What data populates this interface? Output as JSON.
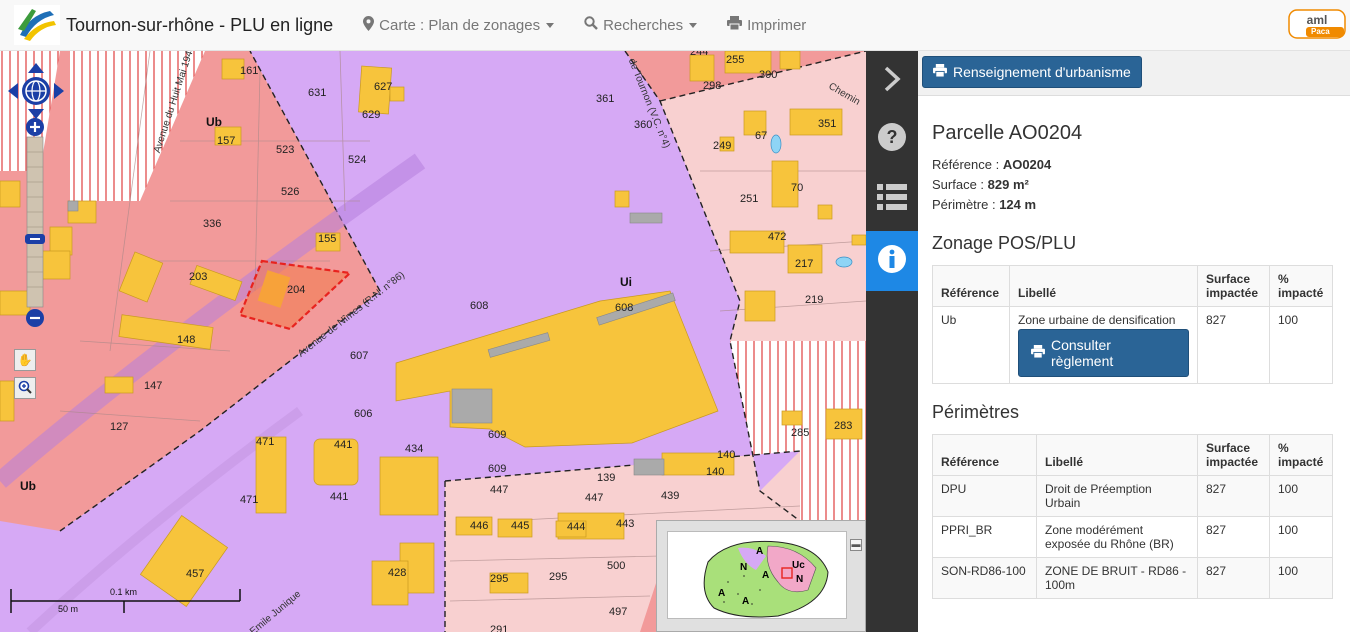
{
  "header": {
    "title": "Tournon-sur-rhône - PLU en ligne",
    "nav": [
      {
        "icon": "map-marker-icon",
        "label": "Carte : Plan de zonages"
      },
      {
        "icon": "search-icon",
        "label": "Recherches"
      },
      {
        "icon": "print-icon",
        "label": "Imprimer"
      }
    ],
    "brand_label": "Paca"
  },
  "map": {
    "zones": [
      "Ub",
      "Ui",
      "Ub"
    ],
    "parcels": [
      "161",
      "631",
      "627",
      "629",
      "157",
      "523",
      "524",
      "526",
      "336",
      "155",
      "203",
      "204",
      "148",
      "607",
      "147",
      "127",
      "606",
      "471",
      "441",
      "434",
      "471",
      "441",
      "608",
      "608",
      "609",
      "609",
      "361",
      "360",
      "249",
      "67",
      "351",
      "70",
      "251",
      "472",
      "217",
      "219",
      "285",
      "283",
      "139",
      "140",
      "140",
      "447",
      "447",
      "439",
      "446",
      "445",
      "444",
      "443",
      "295",
      "295",
      "500",
      "497",
      "291",
      "457",
      "428",
      "244",
      "255",
      "300",
      "298"
    ],
    "streets": [
      "Avenue du Huit Mai 1945",
      "Avenue de Nîmes (R.N. n°86)",
      "de Tournon (V.C. n°4)",
      "Chemin",
      "Emile Junique"
    ],
    "scale": {
      "km": "0.1 km",
      "m": "50 m"
    },
    "overview_labels": [
      "A",
      "N",
      "A",
      "A",
      "A",
      "Uc",
      "N"
    ]
  },
  "strip": [
    {
      "icon": "chevron-right-icon"
    },
    {
      "icon": "help-icon"
    },
    {
      "icon": "list-icon"
    },
    {
      "icon": "info-icon",
      "active": true
    }
  ],
  "panel": {
    "toolbar_button": "Renseignement d'urbanisme",
    "title": "Parcelle AO0204",
    "reference_label": "Référence : ",
    "reference": "AO0204",
    "surface_label": "Surface : ",
    "surface": "829 m²",
    "perimetre_label": "Périmètre : ",
    "perimetre": "124 m",
    "zonage": {
      "title": "Zonage POS/PLU",
      "headers": [
        "Référence",
        "Libellé",
        "Surface impactée",
        "% impacté"
      ],
      "rows": [
        {
          "ref": "Ub",
          "libelle": "Zone urbaine de densification",
          "surface": "827",
          "pct": "100",
          "button": "Consulter règlement"
        }
      ]
    },
    "perimetres": {
      "title": "Périmètres",
      "headers": [
        "Référence",
        "Libellé",
        "Surface impactée",
        "% impacté"
      ],
      "rows": [
        {
          "ref": "DPU",
          "libelle": "Droit de Préemption Urbain",
          "surface": "827",
          "pct": "100"
        },
        {
          "ref": "PPRI_BR",
          "libelle": "Zone modérément exposée du Rhône (BR)",
          "surface": "827",
          "pct": "100"
        },
        {
          "ref": "SON-RD86-100",
          "libelle": "ZONE DE BRUIT - RD86 - 100m",
          "surface": "827",
          "pct": "100"
        }
      ]
    }
  }
}
